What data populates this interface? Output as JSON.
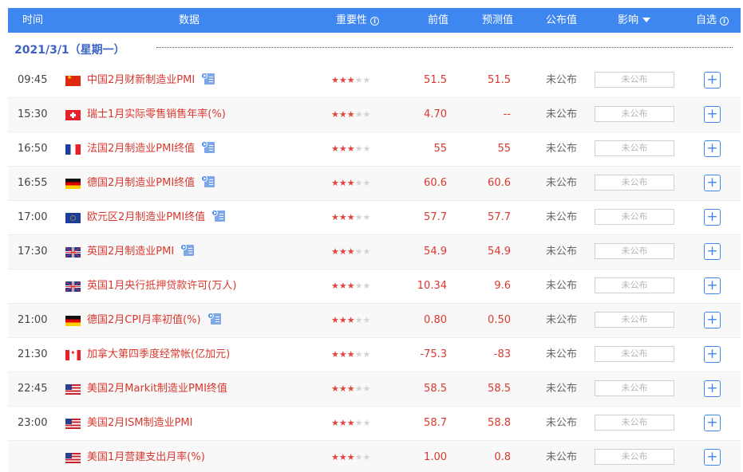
{
  "header": {
    "time": "时间",
    "data": "数据",
    "importance": "重要性",
    "previous": "前值",
    "forecast": "预测值",
    "actual": "公布值",
    "impact": "影响",
    "watchlist": "自选"
  },
  "date_label": "2021/3/1（星期一）",
  "colors": {
    "header_bg": "#3e86f0",
    "event_text": "#d9382f",
    "star_active": "#e2453c",
    "date_text": "#3b62c4"
  },
  "rows": [
    {
      "time": "09:45",
      "flag": "cn",
      "name": "中国2月财新制造业PMI",
      "video": true,
      "stars": 3,
      "prev": "51.5",
      "forecast": "51.5",
      "actual": "未公布",
      "impact": "未公布"
    },
    {
      "time": "15:30",
      "flag": "ch",
      "name": "瑞士1月实际零售销售年率(%)",
      "video": false,
      "stars": 3,
      "prev": "4.70",
      "forecast": "--",
      "actual": "未公布",
      "impact": "未公布"
    },
    {
      "time": "16:50",
      "flag": "fr",
      "name": "法国2月制造业PMI终值",
      "video": true,
      "stars": 3,
      "prev": "55",
      "forecast": "55",
      "actual": "未公布",
      "impact": "未公布"
    },
    {
      "time": "16:55",
      "flag": "de",
      "name": "德国2月制造业PMI终值",
      "video": true,
      "stars": 3,
      "prev": "60.6",
      "forecast": "60.6",
      "actual": "未公布",
      "impact": "未公布"
    },
    {
      "time": "17:00",
      "flag": "eu",
      "name": "欧元区2月制造业PMI终值",
      "video": true,
      "stars": 3,
      "prev": "57.7",
      "forecast": "57.7",
      "actual": "未公布",
      "impact": "未公布"
    },
    {
      "time": "17:30",
      "flag": "gb",
      "name": "英国2月制造业PMI",
      "video": true,
      "stars": 3,
      "prev": "54.9",
      "forecast": "54.9",
      "actual": "未公布",
      "impact": "未公布"
    },
    {
      "time": "",
      "flag": "gb",
      "name": "英国1月央行抵押贷款许可(万人)",
      "video": false,
      "stars": 3,
      "prev": "10.34",
      "forecast": "9.6",
      "actual": "未公布",
      "impact": "未公布"
    },
    {
      "time": "21:00",
      "flag": "de",
      "name": "德国2月CPI月率初值(%)",
      "video": true,
      "stars": 3,
      "prev": "0.80",
      "forecast": "0.50",
      "actual": "未公布",
      "impact": "未公布"
    },
    {
      "time": "21:30",
      "flag": "ca",
      "name": "加拿大第四季度经常帐(亿加元)",
      "video": false,
      "stars": 3,
      "prev": "-75.3",
      "forecast": "-83",
      "actual": "未公布",
      "impact": "未公布"
    },
    {
      "time": "22:45",
      "flag": "us",
      "name": "美国2月Markit制造业PMI终值",
      "video": false,
      "stars": 3,
      "prev": "58.5",
      "forecast": "58.5",
      "actual": "未公布",
      "impact": "未公布"
    },
    {
      "time": "23:00",
      "flag": "us",
      "name": "美国2月ISM制造业PMI",
      "video": false,
      "stars": 3,
      "prev": "58.7",
      "forecast": "58.8",
      "actual": "未公布",
      "impact": "未公布"
    },
    {
      "time": "",
      "flag": "us",
      "name": "美国1月营建支出月率(%)",
      "video": false,
      "stars": 3,
      "prev": "1.00",
      "forecast": "0.8",
      "actual": "未公布",
      "impact": "未公布"
    }
  ]
}
